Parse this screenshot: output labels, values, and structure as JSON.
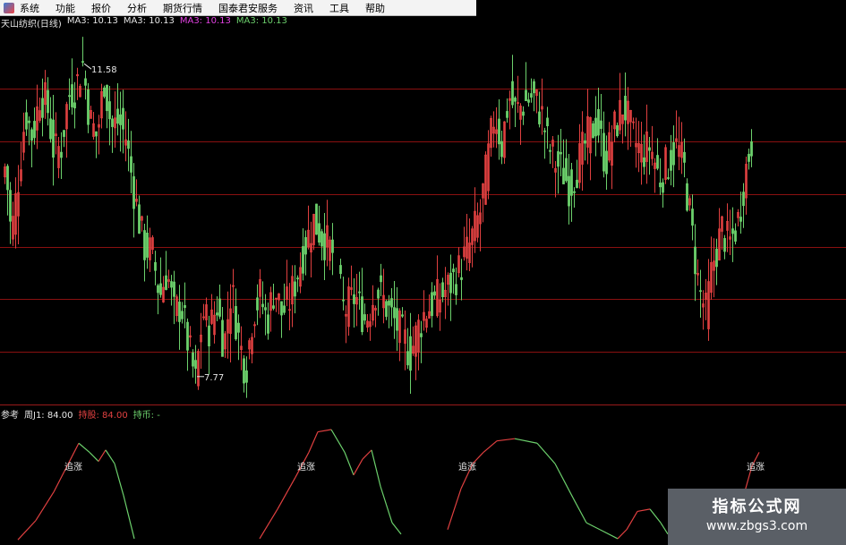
{
  "menu": [
    "系统",
    "功能",
    "报价",
    "分析",
    "期货行情",
    "国泰君安服务",
    "资讯",
    "工具",
    "帮助"
  ],
  "main_info": {
    "title": "天山纺织(日线)",
    "ma_items": [
      {
        "text": "MA3: 10.13",
        "color": "#e6e6e6"
      },
      {
        "text": "MA3: 10.13",
        "color": "#e6e6e6"
      },
      {
        "text": "MA3: 10.13",
        "color": "#e040e0"
      },
      {
        "text": "MA3: 10.13",
        "color": "#6cd06c"
      }
    ]
  },
  "indicator_info": {
    "name": "参考",
    "items": [
      {
        "text": "周J1: 84.00",
        "color": "#e6e6e6"
      },
      {
        "text": "持股: 84.00",
        "color": "#e04040"
      },
      {
        "text": "持币: -",
        "color": "#6cd06c"
      }
    ]
  },
  "watermark": {
    "title": "指标公式网",
    "url": "www.zbgs3.com"
  },
  "colors": {
    "up": "#e04040",
    "down": "#6cd06c",
    "grid": "#8a1010",
    "bg": "#000000"
  },
  "chart_data": [
    {
      "type": "candlestick",
      "title": "天山纺织(日线)",
      "annotations": [
        {
          "label": "11.58",
          "kind": "high"
        },
        {
          "label": "7.77",
          "kind": "low"
        }
      ],
      "ylim": [
        7.5,
        12.0
      ],
      "price_path": [
        [
          0,
          10.1
        ],
        [
          6,
          10.4
        ],
        [
          12,
          9.5
        ],
        [
          20,
          10.2
        ],
        [
          28,
          11.0
        ],
        [
          36,
          10.7
        ],
        [
          44,
          11.2
        ],
        [
          52,
          11.1
        ],
        [
          60,
          10.5
        ],
        [
          68,
          10.6
        ],
        [
          76,
          11.2
        ],
        [
          84,
          11.3
        ],
        [
          92,
          11.58
        ],
        [
          100,
          10.9
        ],
        [
          108,
          10.7
        ],
        [
          116,
          11.4
        ],
        [
          124,
          10.8
        ],
        [
          132,
          10.9
        ],
        [
          140,
          10.7
        ],
        [
          150,
          10.0
        ],
        [
          160,
          9.4
        ],
        [
          170,
          9.3
        ],
        [
          178,
          8.8
        ],
        [
          186,
          9.1
        ],
        [
          194,
          8.6
        ],
        [
          202,
          8.7
        ],
        [
          210,
          8.2
        ],
        [
          218,
          7.77
        ],
        [
          226,
          8.6
        ],
        [
          234,
          8.4
        ],
        [
          242,
          8.7
        ],
        [
          250,
          8.2
        ],
        [
          258,
          8.9
        ],
        [
          266,
          8.3
        ],
        [
          274,
          7.9
        ],
        [
          282,
          8.6
        ],
        [
          290,
          8.8
        ],
        [
          298,
          8.5
        ],
        [
          306,
          8.9
        ],
        [
          314,
          8.6
        ],
        [
          322,
          8.7
        ],
        [
          330,
          9.0
        ],
        [
          340,
          9.4
        ],
        [
          350,
          9.7
        ],
        [
          360,
          9.5
        ],
        [
          372,
          9.3
        ],
        [
          384,
          8.6
        ],
        [
          396,
          8.8
        ],
        [
          408,
          8.5
        ],
        [
          420,
          8.9
        ],
        [
          430,
          8.7
        ],
        [
          440,
          8.5
        ],
        [
          450,
          8.3
        ],
        [
          458,
          8.1
        ],
        [
          466,
          8.4
        ],
        [
          474,
          8.6
        ],
        [
          482,
          8.7
        ],
        [
          492,
          8.8
        ],
        [
          500,
          8.9
        ],
        [
          512,
          9.1
        ],
        [
          524,
          9.4
        ],
        [
          536,
          9.8
        ],
        [
          544,
          10.4
        ],
        [
          552,
          11.0
        ],
        [
          560,
          10.6
        ],
        [
          568,
          11.2
        ],
        [
          576,
          11.0
        ],
        [
          584,
          11.1
        ],
        [
          594,
          11.2
        ],
        [
          604,
          11.0
        ],
        [
          612,
          10.6
        ],
        [
          620,
          10.4
        ],
        [
          628,
          10.3
        ],
        [
          636,
          10.1
        ],
        [
          646,
          10.4
        ],
        [
          656,
          10.7
        ],
        [
          666,
          10.9
        ],
        [
          676,
          10.4
        ],
        [
          686,
          10.8
        ],
        [
          696,
          11.1
        ],
        [
          706,
          10.7
        ],
        [
          716,
          10.5
        ],
        [
          726,
          10.6
        ],
        [
          736,
          10.2
        ],
        [
          746,
          10.4
        ],
        [
          756,
          10.6
        ],
        [
          764,
          10.3
        ],
        [
          772,
          9.6
        ],
        [
          780,
          8.9
        ],
        [
          788,
          8.6
        ],
        [
          796,
          9.2
        ],
        [
          806,
          9.6
        ],
        [
          814,
          9.4
        ],
        [
          824,
          9.7
        ],
        [
          834,
          10.4
        ],
        [
          840,
          10.7
        ]
      ]
    },
    {
      "type": "line",
      "series": [
        {
          "name": "周J1",
          "last_value": 84.0
        }
      ],
      "labels": [
        "追涨",
        "追涨",
        "追涨",
        "追涨"
      ],
      "ylim": [
        0,
        100
      ],
      "path": [
        [
          20,
          3
        ],
        [
          40,
          20
        ],
        [
          60,
          45
        ],
        [
          75,
          68
        ],
        [
          88,
          88
        ],
        [
          100,
          80
        ],
        [
          110,
          72
        ],
        [
          118,
          82
        ],
        [
          128,
          70
        ],
        [
          138,
          42
        ],
        [
          150,
          4
        ],
        [
          290,
          4
        ],
        [
          310,
          30
        ],
        [
          330,
          58
        ],
        [
          345,
          80
        ],
        [
          355,
          98
        ],
        [
          370,
          100
        ],
        [
          385,
          80
        ],
        [
          395,
          60
        ],
        [
          405,
          74
        ],
        [
          415,
          82
        ],
        [
          425,
          50
        ],
        [
          438,
          18
        ],
        [
          448,
          8
        ],
        [
          500,
          12
        ],
        [
          515,
          48
        ],
        [
          528,
          70
        ],
        [
          540,
          80
        ],
        [
          555,
          90
        ],
        [
          575,
          92
        ],
        [
          600,
          88
        ],
        [
          620,
          70
        ],
        [
          640,
          40
        ],
        [
          655,
          18
        ],
        [
          670,
          12
        ],
        [
          690,
          4
        ],
        [
          700,
          12
        ],
        [
          712,
          28
        ],
        [
          726,
          30
        ],
        [
          738,
          18
        ],
        [
          746,
          8
        ],
        [
          830,
          40
        ],
        [
          840,
          68
        ],
        [
          848,
          80
        ]
      ]
    }
  ]
}
